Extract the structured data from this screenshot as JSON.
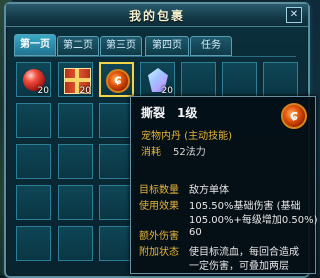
{
  "window": {
    "title": "我的包裹"
  },
  "tabs": [
    "第一页",
    "第二页",
    "第三页",
    "第四页",
    "任务"
  ],
  "slots": [
    {
      "icon": "red-ball-icon",
      "count": "20"
    },
    {
      "icon": "gift-box-icon",
      "count": "20"
    },
    {
      "icon": "skill-orb-icon",
      "count": ""
    },
    {
      "icon": "crystal-icon",
      "count": "20"
    }
  ],
  "tooltip": {
    "name": "撕裂",
    "level": "1级",
    "type": "宠物内丹 (主动技能)",
    "cost_label": "消耗",
    "cost_value": "52法力",
    "rows": [
      {
        "label": "目标数量",
        "value": "敌方单体"
      },
      {
        "label": "使用效果",
        "value": "105.50%基础伤害 (基础"
      },
      {
        "label": "",
        "value": "105.00%+每级增加0.50%)"
      },
      {
        "label": "额外伤害",
        "value": "60"
      },
      {
        "label": "附加状态",
        "value": "使目标流血，每回合造成"
      },
      {
        "label": "",
        "value": "一定伤害，可叠加两层"
      }
    ]
  },
  "colors": {
    "accent": "#e7b33a",
    "tab_active": "#3aa9c7"
  }
}
